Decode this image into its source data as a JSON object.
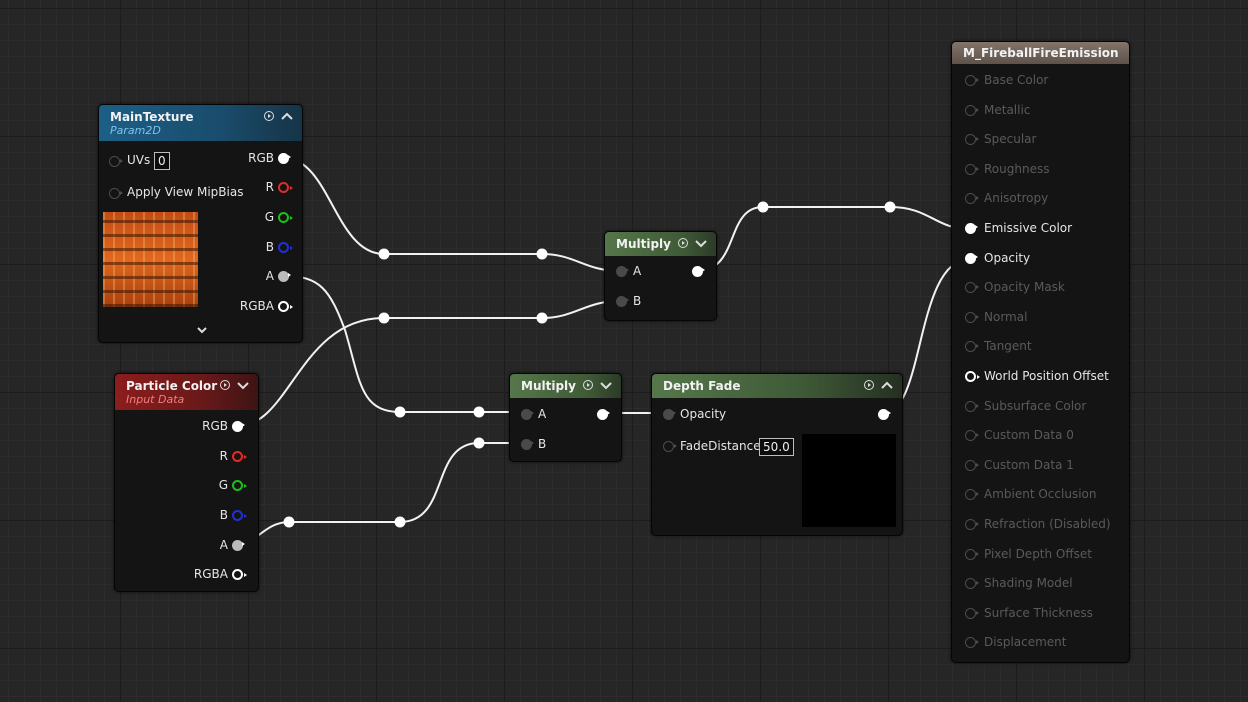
{
  "nodes": {
    "main_texture": {
      "title": "MainTexture",
      "subtitle": "Param2D",
      "header_color": "#1c5f86",
      "inputs": [
        {
          "label": "UVs",
          "value": "0"
        },
        {
          "label": "Apply View MipBias"
        }
      ],
      "outputs": [
        "RGB",
        "R",
        "G",
        "B",
        "A",
        "RGBA"
      ]
    },
    "particle_color": {
      "title": "Particle Color",
      "subtitle": "Input Data",
      "header_color": "#8c1d1d",
      "outputs": [
        "RGB",
        "R",
        "G",
        "B",
        "A",
        "RGBA"
      ]
    },
    "multiply_top": {
      "title": "Multiply",
      "header_color": "#55774a",
      "inputs": [
        "A",
        "B"
      ]
    },
    "multiply_bottom": {
      "title": "Multiply",
      "header_color": "#55774a",
      "inputs": [
        "A",
        "B"
      ]
    },
    "depth_fade": {
      "title": "Depth Fade",
      "header_color": "#55774a",
      "inputs": [
        {
          "label": "Opacity"
        },
        {
          "label": "FadeDistance",
          "value": "50.0"
        }
      ]
    },
    "material": {
      "title": "M_FireballFireEmission",
      "header_color": "#6f6258",
      "pins": [
        {
          "label": "Base Color",
          "active": false
        },
        {
          "label": "Metallic",
          "active": false
        },
        {
          "label": "Specular",
          "active": false
        },
        {
          "label": "Roughness",
          "active": false
        },
        {
          "label": "Anisotropy",
          "active": false
        },
        {
          "label": "Emissive Color",
          "active": true
        },
        {
          "label": "Opacity",
          "active": true
        },
        {
          "label": "Opacity Mask",
          "active": false
        },
        {
          "label": "Normal",
          "active": false
        },
        {
          "label": "Tangent",
          "active": false
        },
        {
          "label": "World Position Offset",
          "active": true
        },
        {
          "label": "Subsurface Color",
          "active": false
        },
        {
          "label": "Custom Data 0",
          "active": false
        },
        {
          "label": "Custom Data 1",
          "active": false
        },
        {
          "label": "Ambient Occlusion",
          "active": false
        },
        {
          "label": "Refraction (Disabled)",
          "active": false
        },
        {
          "label": "Pixel Depth Offset",
          "active": false
        },
        {
          "label": "Shading Model",
          "active": false
        },
        {
          "label": "Surface Thickness",
          "active": false
        },
        {
          "label": "Displacement",
          "active": false
        }
      ]
    }
  }
}
